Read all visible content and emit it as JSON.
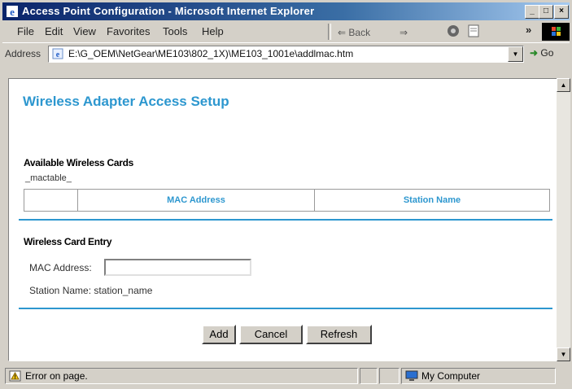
{
  "window": {
    "title": "Access Point Configuration - Microsoft Internet Explorer",
    "controls": {
      "minimize": "_",
      "maximize": "□",
      "close": "×"
    }
  },
  "menu": {
    "items": [
      {
        "label": "File"
      },
      {
        "label": "Edit"
      },
      {
        "label": "View"
      },
      {
        "label": "Favorites"
      },
      {
        "label": "Tools"
      },
      {
        "label": "Help"
      }
    ],
    "overflow": "»"
  },
  "toolbar": {
    "back_label": "⇐ Back",
    "forward_label": "⇒",
    "stop_icon": "stop-icon",
    "refresh_icon": "refresh-icon"
  },
  "address": {
    "label": "Address",
    "url": "E:\\G_OEM\\NetGear\\ME103\\802_1X)\\ME103_1001e\\addlmac.htm",
    "go_label": "Go"
  },
  "page": {
    "title": "Wireless Adapter Access Setup",
    "available_heading": "Available Wireless Cards",
    "table_placeholder": "_mactable_",
    "table_columns": [
      "",
      "MAC Address",
      "Station Name"
    ],
    "entry_heading": "Wireless Card Entry",
    "mac_label": "MAC Address:",
    "mac_value": "",
    "station_label": "Station Name:",
    "station_value": "station_name",
    "buttons": {
      "add": "Add",
      "cancel": "Cancel",
      "refresh": "Refresh"
    }
  },
  "status": {
    "message": "Error on page.",
    "zone": "My Computer"
  },
  "colors": {
    "accent": "#2d97cf",
    "titlebar_start": "#0a246a",
    "titlebar_end": "#a6caf0"
  }
}
